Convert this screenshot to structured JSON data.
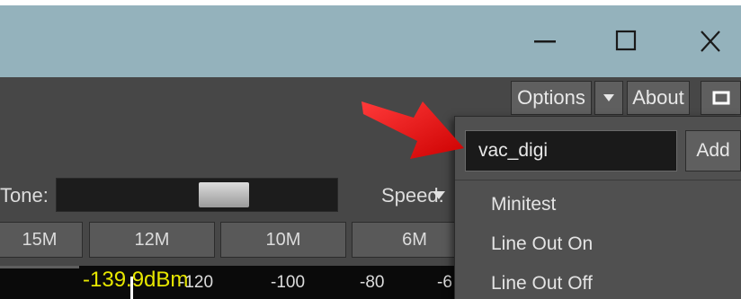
{
  "window_controls": {
    "minimize_glyph": "—",
    "maximize_glyph": "☐",
    "close_glyph": "✕"
  },
  "toolbar": {
    "options_label": "Options",
    "about_label": "About"
  },
  "controls": {
    "tone_label": "Tone:",
    "speed_label": "Speed:"
  },
  "bands": [
    "15M",
    "12M",
    "10M",
    "6M"
  ],
  "meter": {
    "reading": "-139.9dBm",
    "scale": [
      "-120",
      "-100",
      "-80",
      "-6"
    ]
  },
  "dropdown": {
    "input_value": "vac_digi",
    "add_label": "Add",
    "items": [
      "Minitest",
      "Line Out On",
      "Line Out Off"
    ]
  },
  "colors": {
    "titlebar": "#94b2bc",
    "app_background": "#474747",
    "meter_reading": "#e6e600",
    "annotation_arrow": "#ee1111"
  }
}
